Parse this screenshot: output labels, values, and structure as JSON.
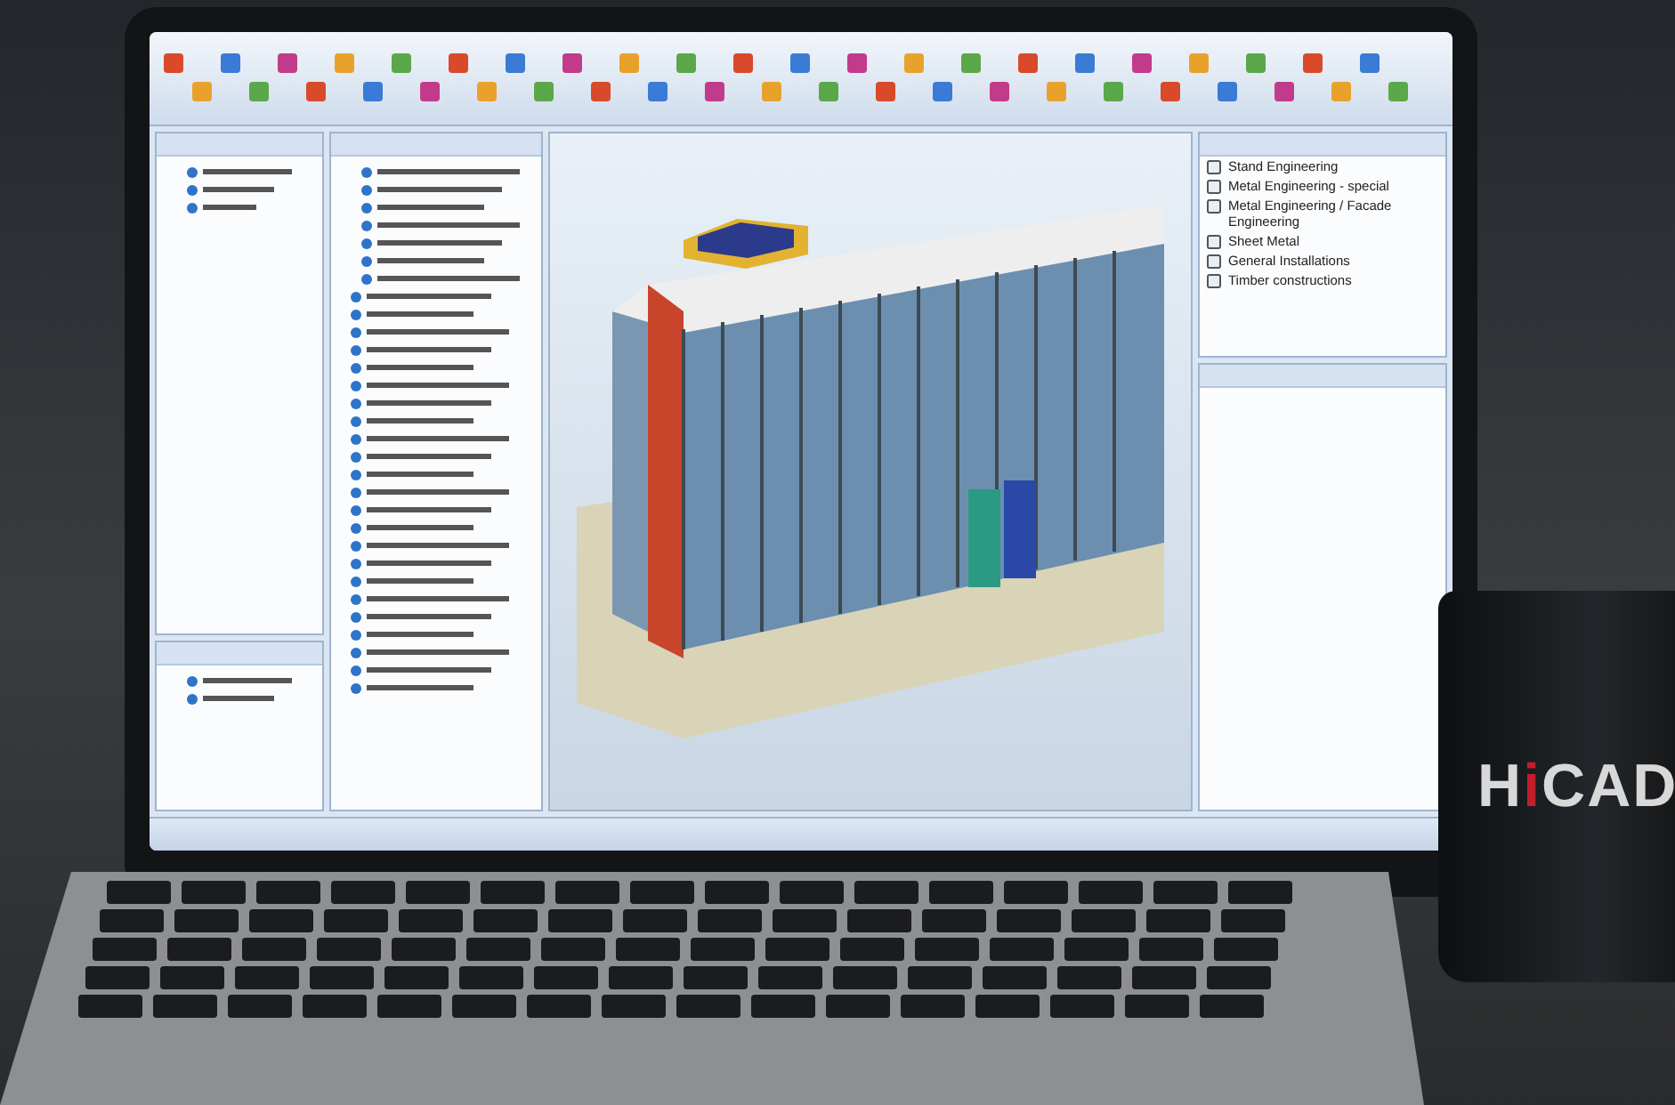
{
  "app": {
    "catalog": {
      "items": [
        {
          "label": "Stand Engineering"
        },
        {
          "label": "Metal Engineering - special"
        },
        {
          "label": "Metal Engineering / Facade Engineering"
        },
        {
          "label": "Sheet Metal"
        },
        {
          "label": "General Installations"
        },
        {
          "label": "Timber constructions"
        }
      ]
    }
  },
  "mug": {
    "logo": [
      {
        "text": "H",
        "color": "#d8d8d8"
      },
      {
        "text": "i",
        "color": "#c21f2b"
      },
      {
        "text": "CAD",
        "color": "#d8d8d8"
      }
    ]
  }
}
